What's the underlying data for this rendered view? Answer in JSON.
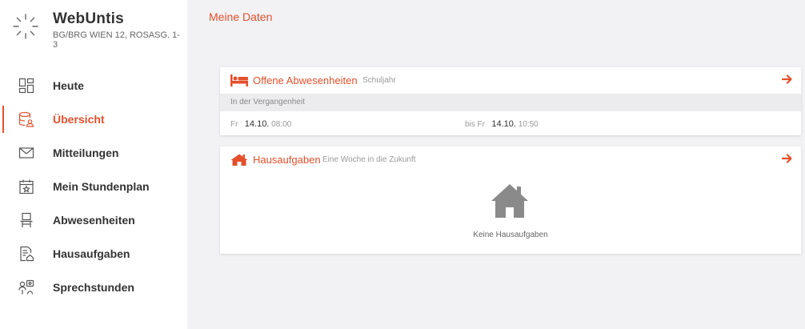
{
  "app": {
    "name": "WebUntis",
    "school": "BG/BRG WIEN 12, ROSASG. 1-3",
    "icon": "spinner-logo-icon"
  },
  "sidebar": {
    "items": [
      {
        "label": "Heute",
        "icon": "dashboard-icon",
        "active": false
      },
      {
        "label": "Übersicht",
        "icon": "overview-icon",
        "active": true
      },
      {
        "label": "Mitteilungen",
        "icon": "envelope-icon",
        "active": false
      },
      {
        "label": "Mein Stundenplan",
        "icon": "calendar-icon",
        "active": false
      },
      {
        "label": "Abwesenheiten",
        "icon": "chair-icon",
        "active": false
      },
      {
        "label": "Hausaufgaben",
        "icon": "homework-icon",
        "active": false
      },
      {
        "label": "Sprechstunden",
        "icon": "consultation-icon",
        "active": false
      }
    ]
  },
  "main": {
    "page_title": "Meine Daten",
    "absences": {
      "title": "Offene Abwesenheiten",
      "subtitle": "Schuljahr",
      "section": "In der Vergangenheit",
      "row": {
        "from_day": "Fr",
        "from_date": "14.10.",
        "from_time": "08:00",
        "to_prefix": "bis Fr",
        "to_date": "14.10.",
        "to_time": "10:50"
      }
    },
    "homework": {
      "title": "Hausaufgaben",
      "subtitle": "Eine Woche in die Zukunft",
      "empty_text": "Keine Hausaufgaben"
    }
  },
  "colors": {
    "accent": "#e4502c",
    "background": "#f2f2f4",
    "text": "#333333"
  }
}
